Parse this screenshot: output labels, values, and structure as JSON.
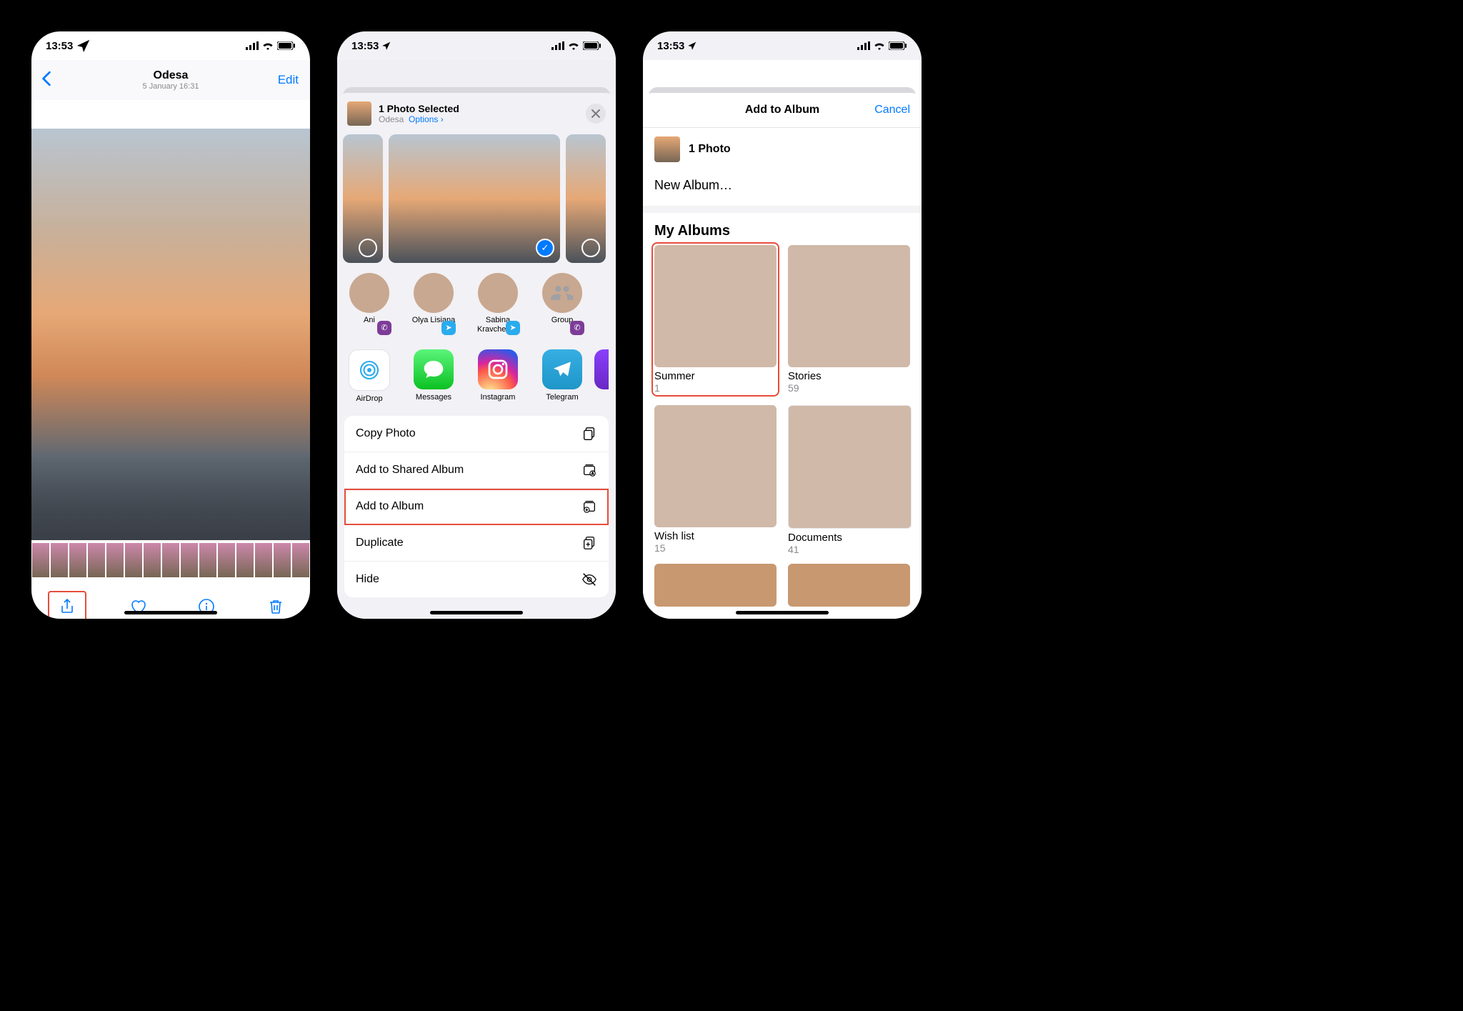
{
  "status": {
    "time": "13:53"
  },
  "phone1": {
    "title": "Odesa",
    "subtitle": "5 January  16:31",
    "edit": "Edit"
  },
  "phone2": {
    "header_title": "1 Photo Selected",
    "header_sub": "Odesa",
    "options": "Options",
    "contacts": [
      {
        "name": "Ani"
      },
      {
        "name": "Olya Lisiana"
      },
      {
        "name": "Sabina Kravchenko"
      },
      {
        "name": "Group"
      }
    ],
    "apps": [
      {
        "name": "AirDrop"
      },
      {
        "name": "Messages"
      },
      {
        "name": "Instagram"
      },
      {
        "name": "Telegram"
      }
    ],
    "actions": [
      {
        "label": "Copy Photo"
      },
      {
        "label": "Add to Shared Album"
      },
      {
        "label": "Add to Album"
      },
      {
        "label": "Duplicate"
      },
      {
        "label": "Hide"
      }
    ]
  },
  "phone3": {
    "title": "Add to Album",
    "cancel": "Cancel",
    "count_label": "1 Photo",
    "new_album": "New Album…",
    "section": "My Albums",
    "albums": [
      {
        "name": "Summer",
        "count": "1"
      },
      {
        "name": "Stories",
        "count": "59"
      },
      {
        "name": "Wish list",
        "count": "15"
      },
      {
        "name": "Documents",
        "count": "41"
      }
    ]
  }
}
